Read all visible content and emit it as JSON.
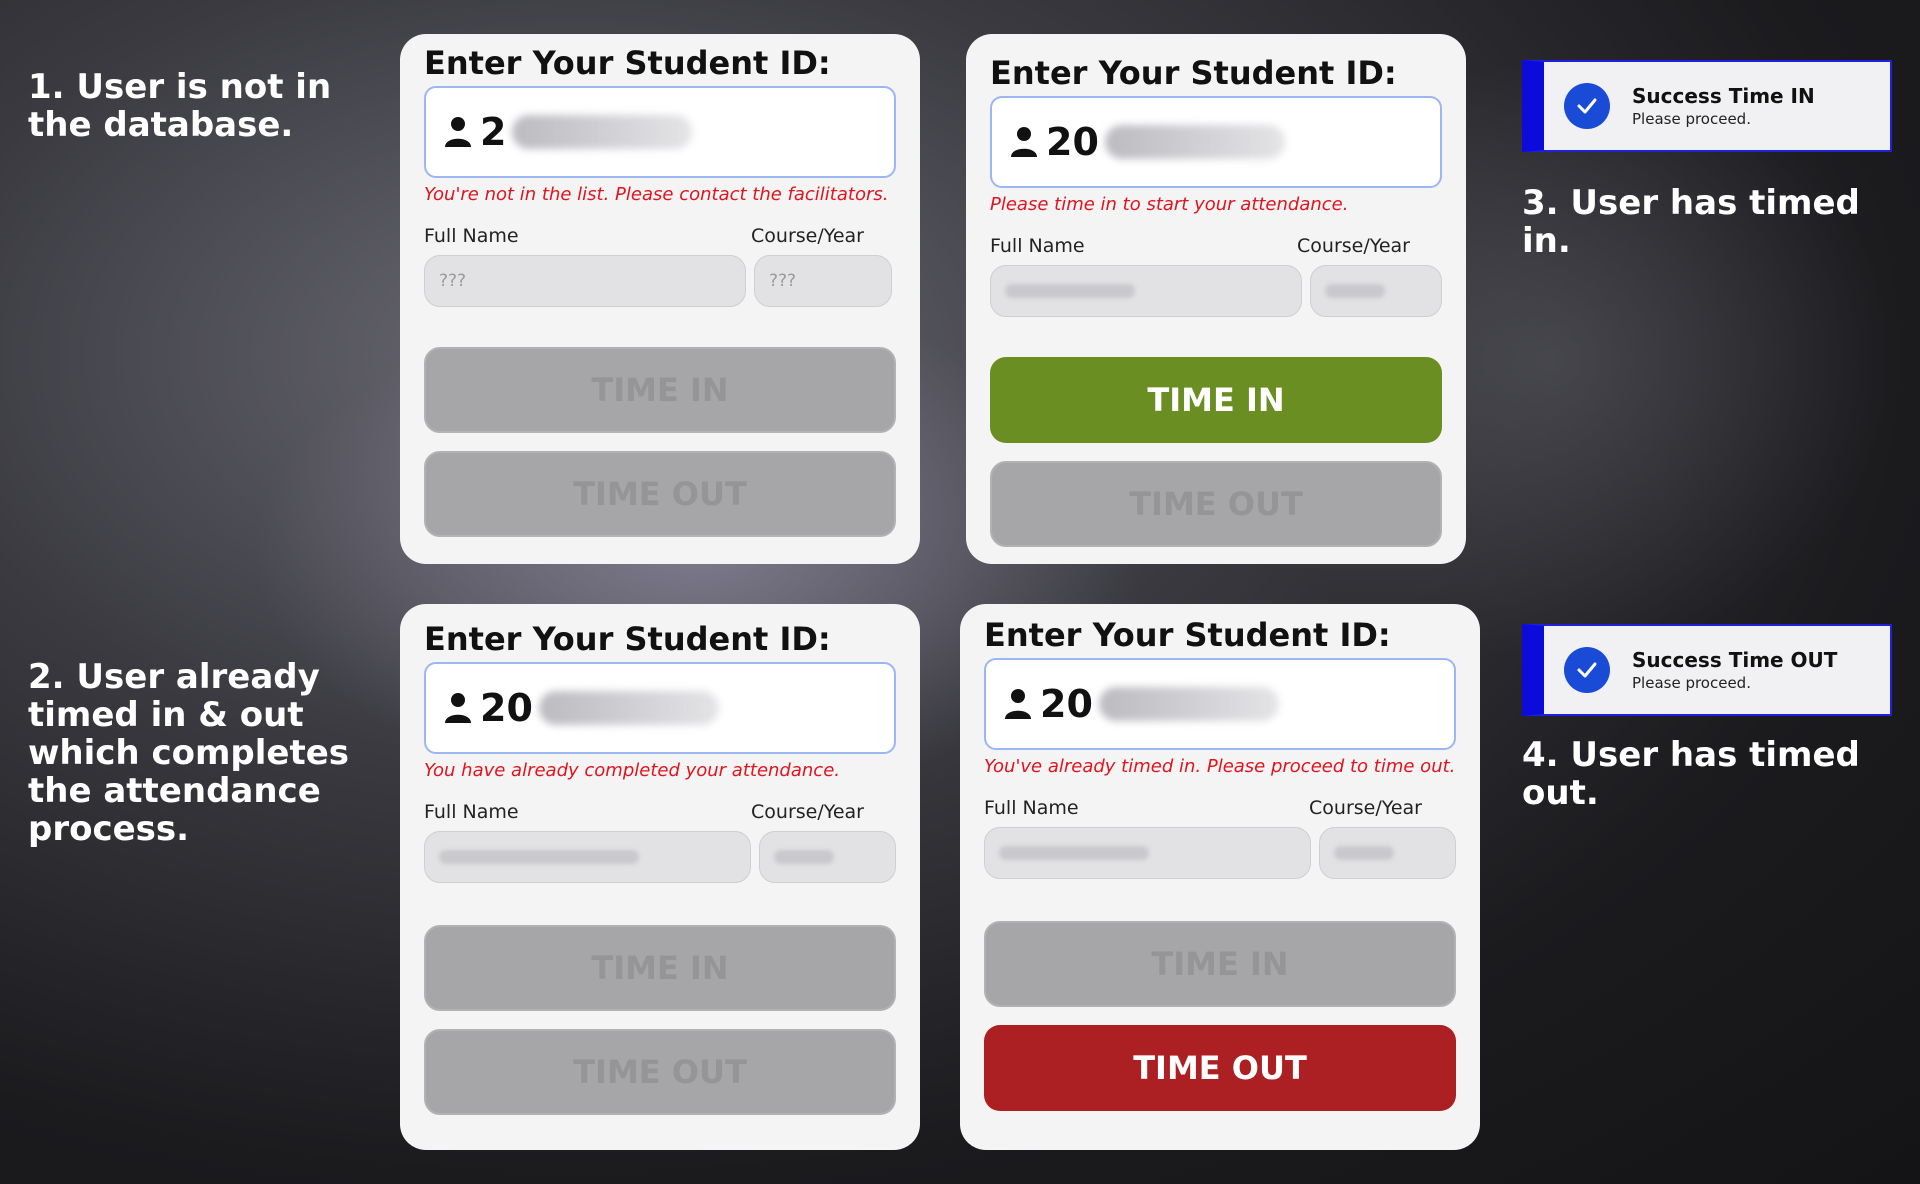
{
  "captions": {
    "c1": "1. User is not in the database.",
    "c2": "2. User already timed in & out which completes the attendance process.",
    "c3": "3. User has timed in.",
    "c4": "4. User has timed out."
  },
  "form": {
    "heading": "Enter Your Student ID:",
    "full_name_label": "Full Name",
    "course_year_label": "Course/Year",
    "time_in_label": "TIME IN",
    "time_out_label": "TIME OUT"
  },
  "panel1": {
    "id_prefix": "2",
    "error": "You're not in the list. Please contact the facilitators.",
    "full_name": "???",
    "course_year": "???",
    "time_in_enabled": false,
    "time_out_enabled": false
  },
  "panel2": {
    "id_prefix": "20",
    "error": "You have already completed your attendance.",
    "time_in_enabled": false,
    "time_out_enabled": false
  },
  "panel3": {
    "id_prefix": "20",
    "error": "Please time in to start your attendance.",
    "time_in_enabled": true,
    "time_out_enabled": false
  },
  "panel4": {
    "id_prefix": "20",
    "error": "You've already timed in. Please proceed to time out.",
    "time_in_enabled": false,
    "time_out_enabled": true
  },
  "toast_in": {
    "title": "Success Time IN",
    "message": "Please proceed."
  },
  "toast_out": {
    "title": "Success Time OUT",
    "message": "Please proceed."
  },
  "colors": {
    "time_in_active": "#6a8e22",
    "time_out_active": "#ac1f22",
    "error": "#e0141e",
    "toast_accent": "#0b0bdb"
  }
}
